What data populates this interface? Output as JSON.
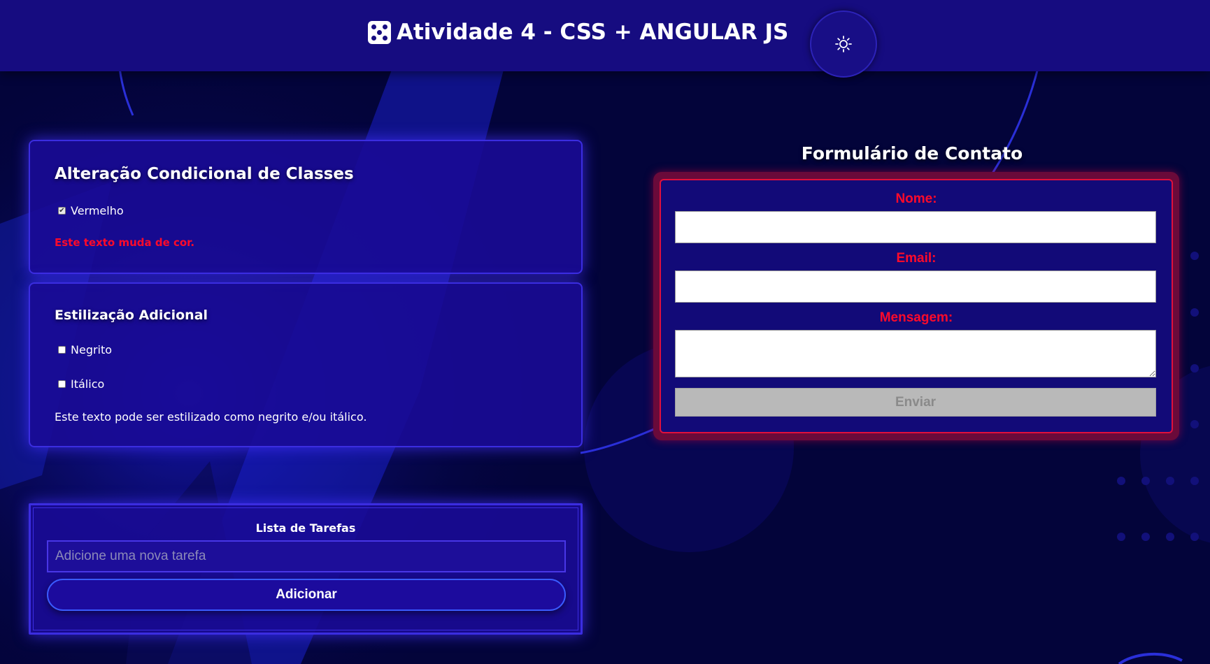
{
  "header": {
    "title": "Atividade 4 - CSS + ANGULAR JS",
    "title_icon": "dice-five-icon",
    "theme_toggle_icon": "sun-icon"
  },
  "conditional_classes": {
    "title": "Alteração Condicional de Classes",
    "checkbox_label": "Vermelho",
    "checkbox_checked": true,
    "text": "Este texto muda de cor.",
    "text_color": "#ff0a2a"
  },
  "additional_styling": {
    "title": "Estilização Adicional",
    "bold_label": "Negrito",
    "bold_checked": false,
    "italic_label": "Itálico",
    "italic_checked": false,
    "text": "Este texto pode ser estilizado como negrito e/ou itálico."
  },
  "tasks": {
    "title": "Lista de Tarefas",
    "input_placeholder": "Adicione uma nova tarefa",
    "input_value": "",
    "add_label": "Adicionar"
  },
  "contact_form": {
    "title": "Formulário de Contato",
    "name_label": "Nome:",
    "name_value": "",
    "email_label": "Email:",
    "email_value": "",
    "message_label": "Mensagem:",
    "message_value": "",
    "submit_label": "Enviar",
    "submit_disabled": true
  },
  "colors": {
    "background": "#03043a",
    "header": "#160c80",
    "card": "#1a0b96",
    "card_border": "#3b2de0",
    "error_red": "#ff0a2a",
    "form_frame": "#6a0a3a"
  }
}
